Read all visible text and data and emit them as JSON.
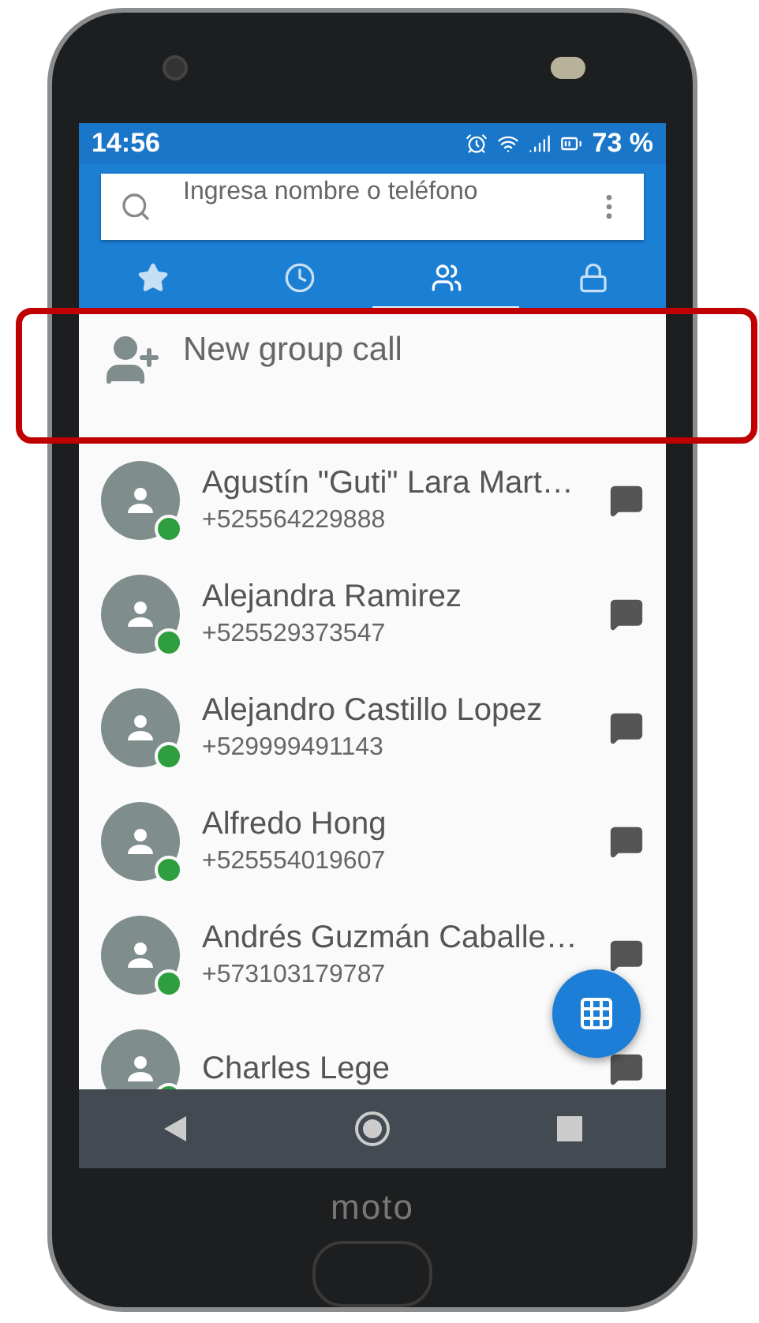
{
  "status_bar": {
    "time": "14:56",
    "battery": "73 %"
  },
  "search": {
    "placeholder": "Ingresa nombre o teléfono"
  },
  "tabs": [
    {
      "kind": "favorites",
      "selected": false
    },
    {
      "kind": "recent",
      "selected": false
    },
    {
      "kind": "contacts",
      "selected": true
    },
    {
      "kind": "lock",
      "selected": false
    }
  ],
  "group_call": {
    "label": "New group call"
  },
  "contacts": [
    {
      "name": "Agustín \"Guti\" Lara Mart…",
      "phone": "+525564229888"
    },
    {
      "name": "Alejandra Ramirez",
      "phone": "+525529373547"
    },
    {
      "name": "Alejandro Castillo Lopez",
      "phone": "+529999491143"
    },
    {
      "name": "Alfredo Hong",
      "phone": "+525554019607"
    },
    {
      "name": "Andrés Guzmán Caballe…",
      "phone": "+573103179787"
    },
    {
      "name": "Charles Lege"
    }
  ],
  "device": {
    "brand": "moto"
  }
}
